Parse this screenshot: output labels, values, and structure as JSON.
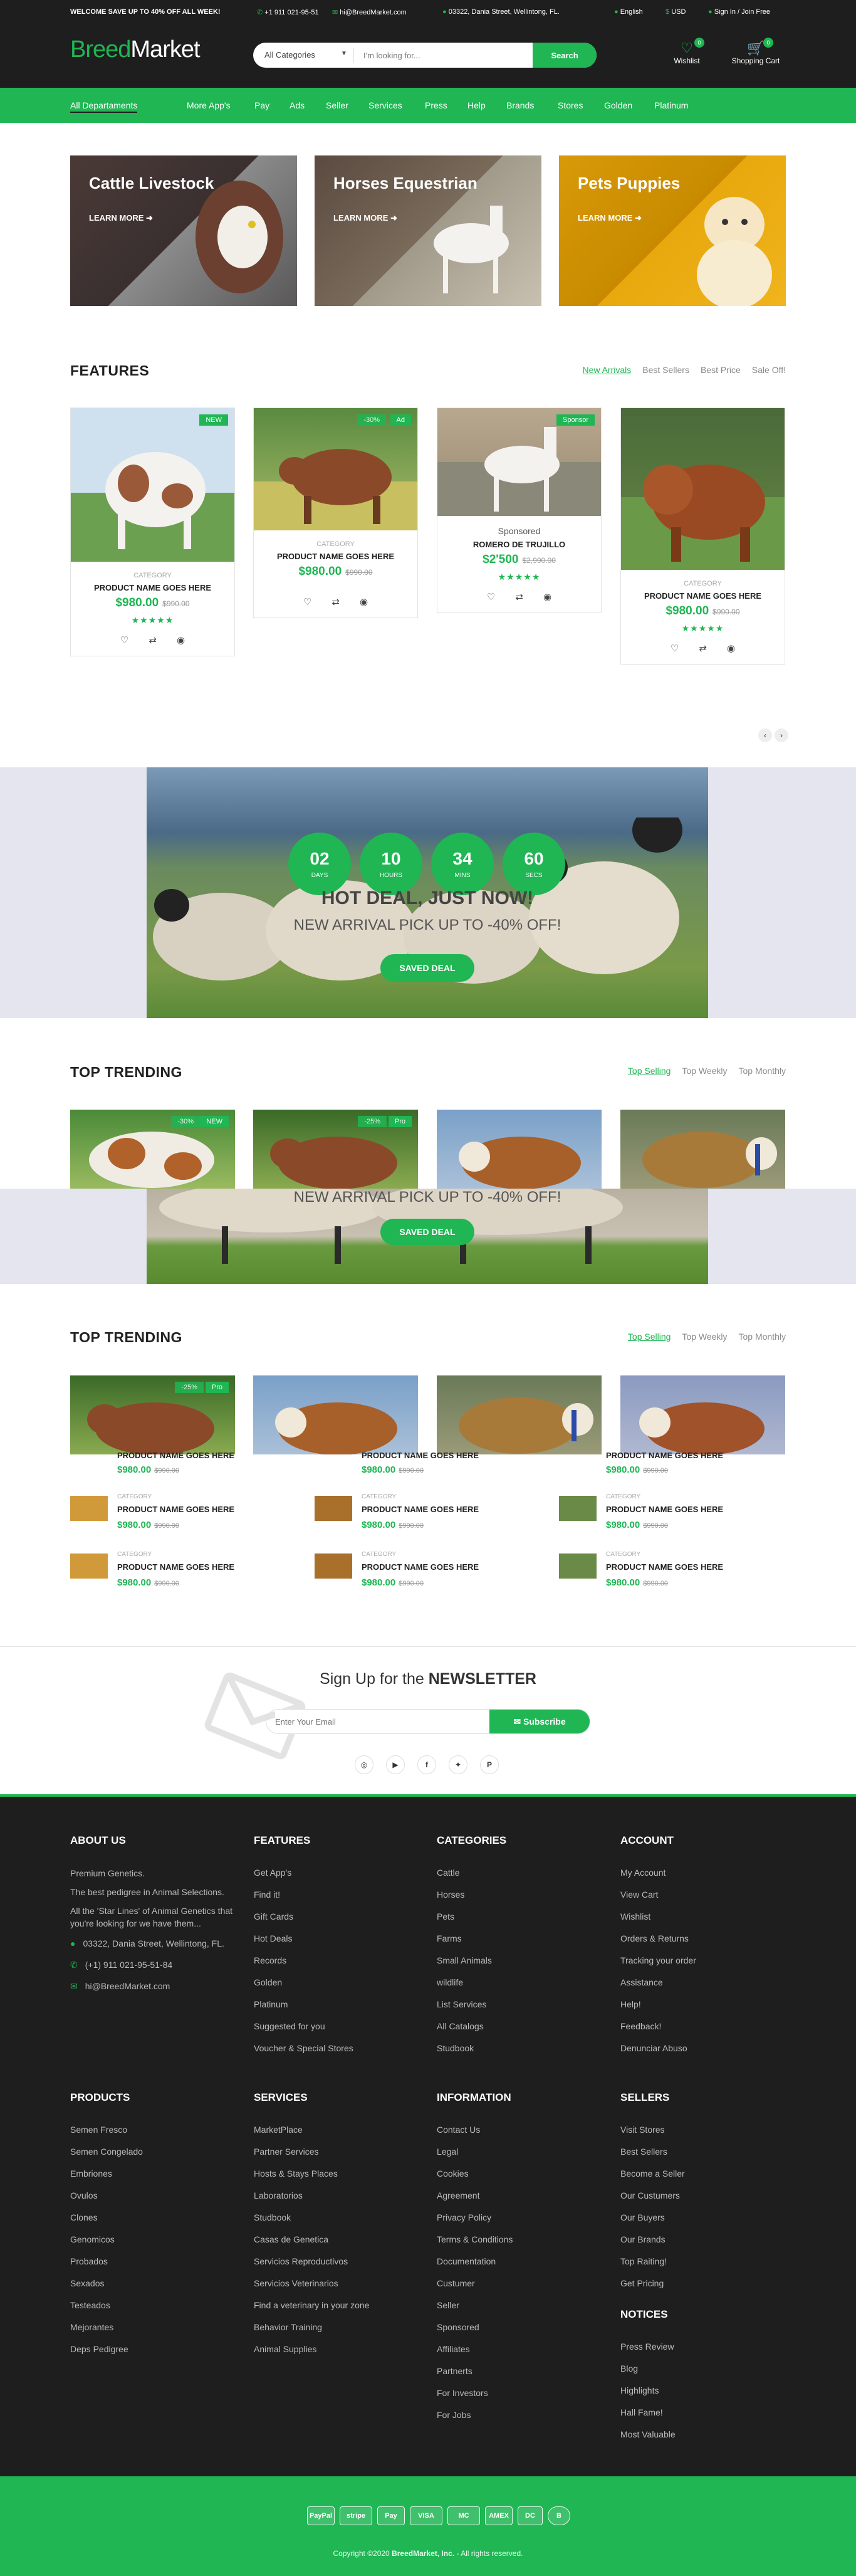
{
  "topbar": {
    "promo": "WELCOME SAVE UP TO 40% OFF ALL WEEK!",
    "phone": "+1 911 021-95-51",
    "email": "hi@BreedMarket.com",
    "address": "03322, Dania Street, Wellintong, FL.",
    "language": "English",
    "currency": "USD",
    "signin": "Sign In / Join Free"
  },
  "header": {
    "logo_a": "Breed",
    "logo_b": "Market",
    "search_category": "All Categories",
    "search_placeholder": "I'm looking for...",
    "search_button": "Search",
    "wishlist_label": "Wishlist",
    "wishlist_count": "0",
    "cart_label": "Shopping Cart",
    "cart_count": "0"
  },
  "nav": [
    "All Departaments",
    "More App's",
    "Pay",
    "Ads",
    "Seller",
    "Services",
    "Press",
    "Help",
    "Brands",
    "Stores",
    "Golden",
    "Platinum"
  ],
  "banners": [
    {
      "title": "Cattle Livestock",
      "more": "LEARN MORE"
    },
    {
      "title": "Horses Equestrian",
      "more": "LEARN MORE"
    },
    {
      "title": "Pets Puppies",
      "more": "LEARN MORE"
    }
  ],
  "features": {
    "title": "FEATURES",
    "tabs": [
      "New Arrivals",
      "Best Sellers",
      "Best Price",
      "Sale Off!"
    ],
    "products": [
      {
        "tag": "NEW",
        "tag2": "",
        "category": "CATEGORY",
        "name": "PRODUCT NAME GOES HERE",
        "price": "$980.00",
        "old": "$990.00",
        "stars": "★★★★★"
      },
      {
        "tag": "Ad",
        "tag2": "-30%",
        "category": "CATEGORY",
        "name": "PRODUCT NAME GOES HERE",
        "price": "$980.00",
        "old": "$990.00",
        "stars": ""
      },
      {
        "tag": "Sponsor",
        "tag2": "",
        "category": "Sponsored",
        "name": "ROMERO DE TRUJILLO",
        "price": "$2'500",
        "old": "$2,990.00",
        "stars": "★★★★★"
      },
      {
        "tag": "",
        "tag2": "",
        "category": "CATEGORY",
        "name": "PRODUCT NAME GOES HERE",
        "price": "$980.00",
        "old": "$990.00",
        "stars": "★★★★★"
      }
    ]
  },
  "hotdeal": {
    "timers": [
      {
        "n": "02",
        "l": "DAYS"
      },
      {
        "n": "10",
        "l": "HOURS"
      },
      {
        "n": "34",
        "l": "MINS"
      },
      {
        "n": "60",
        "l": "SECS"
      }
    ],
    "title": "HOT DEAL, JUST NOW!",
    "subtitle": "NEW ARRIVAL PICK UP TO -40% OFF!",
    "button": "SAVED DEAL"
  },
  "trending1": {
    "title": "TOP TRENDING",
    "tabs": [
      "Top Selling",
      "Top Weekly",
      "Top Monthly"
    ],
    "tags": [
      {
        "a": "-30%",
        "b": "NEW"
      },
      {
        "a": "-25%",
        "b": "Pro"
      }
    ]
  },
  "overlap": {
    "subtitle": "NEW ARRIVAL PICK UP TO -40% OFF!",
    "button": "SAVED DEAL"
  },
  "trending2": {
    "title": "TOP TRENDING",
    "tabs": [
      "Top Selling",
      "Top Weekly",
      "Top Monthly"
    ],
    "tag_a": "-25%",
    "tag_b": "Pro",
    "rows": [
      [
        {
          "category": "",
          "name": "PRODUCT NAME GOES HERE",
          "price": "$980.00",
          "old": "$990.00"
        },
        {
          "category": "",
          "name": "PRODUCT NAME GOES HERE",
          "price": "$980.00",
          "old": "$990.00"
        },
        {
          "category": "",
          "name": "PRODUCT NAME GOES HERE",
          "price": "$980.00",
          "old": "$990.00"
        }
      ],
      [
        {
          "category": "CATEGORY",
          "name": "PRODUCT NAME GOES HERE",
          "price": "$980.00",
          "old": "$990.00"
        },
        {
          "category": "CATEGORY",
          "name": "PRODUCT NAME GOES HERE",
          "price": "$980.00",
          "old": "$990.00"
        },
        {
          "category": "CATEGORY",
          "name": "PRODUCT NAME GOES HERE",
          "price": "$980.00",
          "old": "$990.00"
        }
      ],
      [
        {
          "category": "CATEGORY",
          "name": "PRODUCT NAME GOES HERE",
          "price": "$980.00",
          "old": "$990.00"
        },
        {
          "category": "CATEGORY",
          "name": "PRODUCT NAME GOES HERE",
          "price": "$980.00",
          "old": "$990.00"
        },
        {
          "category": "CATEGORY",
          "name": "PRODUCT NAME GOES HERE",
          "price": "$980.00",
          "old": "$990.00"
        }
      ]
    ]
  },
  "newsletter": {
    "title_a": "Sign Up for the ",
    "title_b": "NEWSLETTER",
    "placeholder": "Enter Your Email",
    "button": "Subscribe"
  },
  "footer": {
    "about": {
      "title": "ABOUT US",
      "lines": [
        "Premium Genetics.",
        "The best pedigree in Animal Selections.",
        "All the 'Star Lines' of Animal Genetics that you're looking for we have them..."
      ],
      "address": "03322, Dania Street, Wellintong, FL.",
      "phone": "(+1) 911 021-95-51-84",
      "email": "hi@BreedMarket.com"
    },
    "features": {
      "title": "FEATURES",
      "items": [
        "Get App's",
        "Find it!",
        "Gift Cards",
        "Hot Deals",
        "Records",
        "Golden",
        "Platinum",
        "Suggested for you",
        "Voucher & Special Stores"
      ]
    },
    "categories": {
      "title": "CATEGORIES",
      "items": [
        "Cattle",
        "Horses",
        "Pets",
        "Farms",
        "Small Animals",
        "wildlife",
        "List Services",
        "All Catalogs",
        "Studbook"
      ]
    },
    "account": {
      "title": "ACCOUNT",
      "items": [
        "My Account",
        "View Cart",
        "Wishlist",
        "Orders & Returns",
        "Tracking your order",
        "Assistance",
        "Help!",
        "Feedback!",
        "Denunciar Abuso"
      ]
    },
    "products": {
      "title": "PRODUCTS",
      "items": [
        "Semen Fresco",
        "Semen Congelado",
        "Embriones",
        "Ovulos",
        "Clones",
        "Genomicos",
        "Probados",
        "Sexados",
        "Testeados",
        "Mejorantes",
        "Deps Pedigree"
      ]
    },
    "services": {
      "title": "SERVICES",
      "items": [
        "MarketPlace",
        "Partner Services",
        "Hosts & Stays Places",
        "Laboratorios",
        "Studbook",
        "Casas de Genetica",
        "Servicios Reproductivos",
        "Servicios Veterinarios",
        "Find a veterinary in your zone",
        "Behavior Training",
        "Animal Supplies"
      ]
    },
    "information": {
      "title": "INFORMATION",
      "items": [
        "Contact Us",
        "Legal",
        "Cookies",
        "Agreement",
        "Privacy Policy",
        "Terms & Conditions",
        "Documentation",
        "Custumer",
        "Seller",
        "Sponsored",
        "Affiliates",
        "Partnerts",
        "For Investors",
        "For Jobs"
      ]
    },
    "sellers": {
      "title": "SELLERS",
      "items": [
        "Visit Stores",
        "Best Sellers",
        "Become a Seller",
        "Our Custumers",
        "Our Buyers",
        "Our Brands",
        "Top Raiting!",
        "Get Pricing"
      ]
    },
    "notices": {
      "title": "NOTICES",
      "items": [
        "Press Review",
        "Blog",
        "Highlights",
        "Hall Fame!",
        "Most Valuable"
      ]
    }
  },
  "payments": [
    "PayPal",
    "stripe",
    "Pay",
    "VISA",
    "MC",
    "AMEX",
    "DC",
    "B"
  ],
  "copyright_a": "Copyright ©2020 ",
  "copyright_b": "BreedMarket, Inc.",
  "copyright_c": " - All rights reserved.",
  "colors": {
    "brand": "#1fb653",
    "dark": "#1e1e1e"
  }
}
